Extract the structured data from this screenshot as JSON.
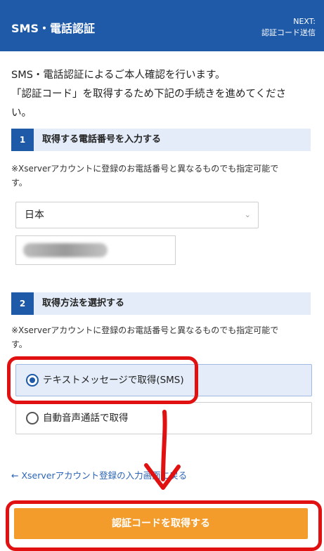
{
  "header": {
    "title": "SMS・電話認証",
    "next_label": "NEXT:",
    "next_value": "認証コード送信"
  },
  "intro": {
    "line1": "SMS・電話認証によるご本人確認を行います。",
    "line2": "「認証コード」を取得するため下記の手続きを進めてくださ",
    "line3": "い。"
  },
  "step1": {
    "number": "1",
    "label": "取得する電話番号を入力する",
    "note_line1": "※Xserverアカウントに登録のお電話番号と異なるものでも指定可能で",
    "note_line2": "す。",
    "country_select": "日本"
  },
  "step2": {
    "number": "2",
    "label": "取得方法を選択する",
    "note_line1": "※Xserverアカウントに登録のお電話番号と異なるものでも指定可能で",
    "note_line2": "す。",
    "options": [
      {
        "label": "テキストメッセージで取得(SMS)",
        "selected": true
      },
      {
        "label": "自動音声通話で取得",
        "selected": false
      }
    ]
  },
  "back_link": "← Xserverアカウント登録の入力画面に戻る",
  "submit_label": "認証コードを取得する",
  "colors": {
    "brand": "#1e5aa8",
    "accent": "#f39c2b",
    "annotation": "#e21111"
  }
}
